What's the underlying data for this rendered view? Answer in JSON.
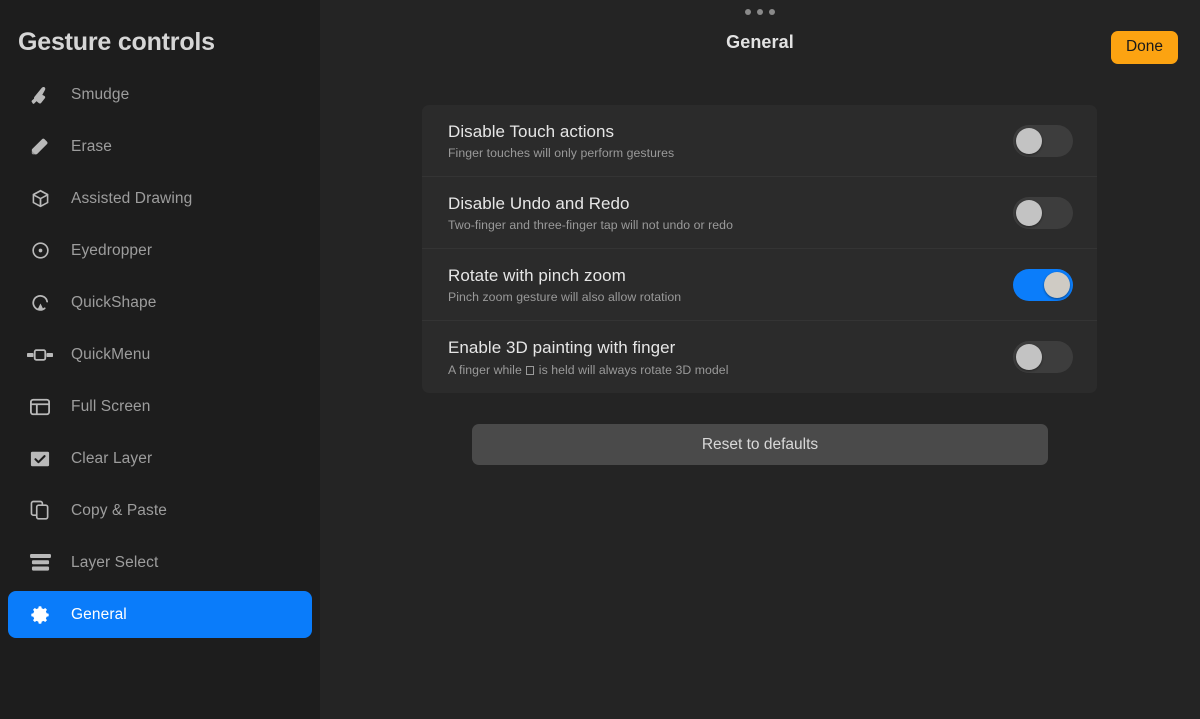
{
  "sidebar": {
    "title": "Gesture controls",
    "items": [
      {
        "label": "Smudge",
        "icon": "smudge-icon",
        "active": false
      },
      {
        "label": "Erase",
        "icon": "eraser-icon",
        "active": false
      },
      {
        "label": "Assisted Drawing",
        "icon": "cube-icon",
        "active": false
      },
      {
        "label": "Eyedropper",
        "icon": "eyedropper-icon",
        "active": false
      },
      {
        "label": "QuickShape",
        "icon": "quickshape-icon",
        "active": false
      },
      {
        "label": "QuickMenu",
        "icon": "quickmenu-icon",
        "active": false
      },
      {
        "label": "Full Screen",
        "icon": "full-screen-icon",
        "active": false
      },
      {
        "label": "Clear Layer",
        "icon": "checkbox-check-icon",
        "active": false
      },
      {
        "label": "Copy & Paste",
        "icon": "copy-paste-icon",
        "active": false
      },
      {
        "label": "Layer Select",
        "icon": "layers-icon",
        "active": false
      },
      {
        "label": "General",
        "icon": "gear-icon",
        "active": true
      }
    ]
  },
  "header": {
    "title": "General",
    "done_label": "Done",
    "grabber_icon": "drag-handle-dots-icon"
  },
  "settings": [
    {
      "title": "Disable Touch actions",
      "subtitle": "Finger touches will only perform gestures",
      "enabled": false
    },
    {
      "title": "Disable Undo and Redo",
      "subtitle": "Two-finger and three-finger tap will not undo or redo",
      "enabled": false
    },
    {
      "title": "Rotate with pinch zoom",
      "subtitle": "Pinch zoom gesture will also allow rotation",
      "enabled": true
    },
    {
      "title": "Enable 3D painting with finger",
      "subtitle_before": "A finger while",
      "subtitle_glyph": "missing-glyph-box",
      "subtitle_after": "is held will always rotate 3D model",
      "enabled": false
    }
  ],
  "reset": {
    "label": "Reset to defaults"
  },
  "colors": {
    "accent_blue": "#0a7cfa",
    "toggle_on_blue": "#0b7dfa",
    "done_orange": "#fca311",
    "sidebar_bg": "#1d1d1d",
    "main_bg": "#242424",
    "card_bg": "#2b2b2b",
    "reset_bg": "#4a4a4a"
  }
}
